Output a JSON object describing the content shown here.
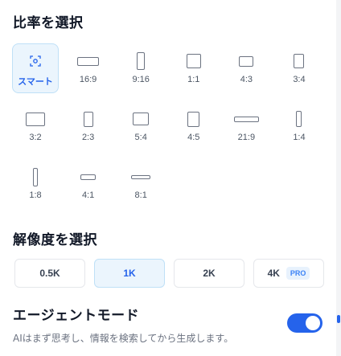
{
  "aspect_section": {
    "title": "比率を選択",
    "options": [
      {
        "label": "スマート",
        "shape": "smart",
        "selected": true
      },
      {
        "label": "16:9",
        "shape": "16:9",
        "selected": false
      },
      {
        "label": "9:16",
        "shape": "9:16",
        "selected": false
      },
      {
        "label": "1:1",
        "shape": "1:1",
        "selected": false
      },
      {
        "label": "4:3",
        "shape": "4:3",
        "selected": false
      },
      {
        "label": "3:4",
        "shape": "3:4",
        "selected": false
      },
      {
        "label": "3:2",
        "shape": "3:2",
        "selected": false
      },
      {
        "label": "2:3",
        "shape": "2:3",
        "selected": false
      },
      {
        "label": "5:4",
        "shape": "5:4",
        "selected": false
      },
      {
        "label": "4:5",
        "shape": "4:5",
        "selected": false
      },
      {
        "label": "21:9",
        "shape": "21:9",
        "selected": false
      },
      {
        "label": "1:4",
        "shape": "1:4",
        "selected": false
      },
      {
        "label": "1:8",
        "shape": "1:8",
        "selected": false
      },
      {
        "label": "4:1",
        "shape": "4:1",
        "selected": false
      },
      {
        "label": "8:1",
        "shape": "8:1",
        "selected": false
      }
    ]
  },
  "resolution_section": {
    "title": "解像度を選択",
    "options": [
      {
        "label": "0.5K",
        "selected": false
      },
      {
        "label": "1K",
        "selected": true
      },
      {
        "label": "2K",
        "selected": false
      },
      {
        "label": "4K",
        "selected": false,
        "badge": "PRO"
      }
    ]
  },
  "agent_mode": {
    "title": "エージェントモード",
    "description": "AIはまず思考し、情報を検索してから生成します。",
    "enabled": true
  },
  "colors": {
    "accent": "#2563eb",
    "selected_bg": "#ebf5fd",
    "selected_border": "#bfe0f7"
  }
}
